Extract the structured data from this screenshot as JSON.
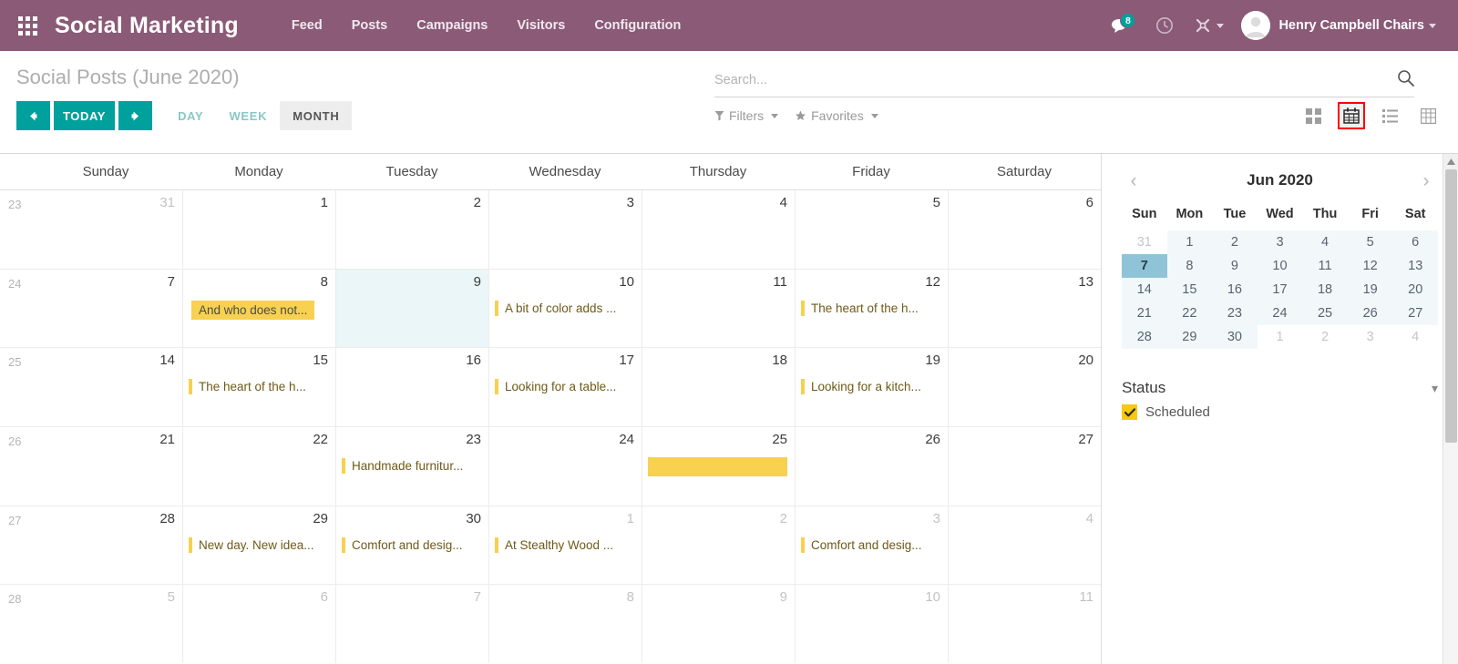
{
  "navbar": {
    "apps_icon": "apps-grid-icon",
    "brand": "Social Marketing",
    "menus": [
      {
        "label": "Feed"
      },
      {
        "label": "Posts"
      },
      {
        "label": "Campaigns"
      },
      {
        "label": "Visitors"
      },
      {
        "label": "Configuration"
      }
    ],
    "messages_icon": "chat-bubble-icon",
    "messages_count": "8",
    "activities_icon": "clock-icon",
    "debug_icon": "bug-tools-icon",
    "avatar_icon": "user-avatar-icon",
    "user_name": "Henry Campbell Chairs",
    "brand_color": "#8a5a77",
    "accent_color": "#00a09d"
  },
  "control_panel": {
    "title": "Social Posts (June 2020)",
    "search": {
      "placeholder": "Search...",
      "value": "",
      "icon": "search-icon"
    },
    "nav": {
      "prev_icon": "arrow-left-icon",
      "today_label": "TODAY",
      "next_icon": "arrow-right-icon"
    },
    "scales": [
      {
        "label": "DAY",
        "active": false
      },
      {
        "label": "WEEK",
        "active": false
      },
      {
        "label": "MONTH",
        "active": true
      }
    ],
    "filters_label": "Filters",
    "filters_icon": "funnel-icon",
    "favorites_label": "Favorites",
    "favorites_icon": "star-icon",
    "views": [
      {
        "name": "kanban-view-icon",
        "active": false
      },
      {
        "name": "calendar-view-icon",
        "active": true
      },
      {
        "name": "list-view-icon",
        "active": false
      },
      {
        "name": "pivot-view-icon",
        "active": false
      }
    ],
    "active_view_highlight": "#ff0000"
  },
  "calendar": {
    "weekdays": [
      "Sunday",
      "Monday",
      "Tuesday",
      "Wednesday",
      "Thursday",
      "Friday",
      "Saturday"
    ],
    "event_color": "#f7d04f",
    "rows": [
      {
        "week": "23",
        "days": [
          {
            "num": "31",
            "other": true,
            "hover": false,
            "events": []
          },
          {
            "num": "1",
            "other": false,
            "hover": false,
            "events": []
          },
          {
            "num": "2",
            "other": false,
            "hover": false,
            "events": []
          },
          {
            "num": "3",
            "other": false,
            "hover": false,
            "events": []
          },
          {
            "num": "4",
            "other": false,
            "hover": false,
            "events": []
          },
          {
            "num": "5",
            "other": false,
            "hover": false,
            "events": []
          },
          {
            "num": "6",
            "other": false,
            "hover": false,
            "events": []
          }
        ]
      },
      {
        "week": "24",
        "days": [
          {
            "num": "7",
            "other": false,
            "hover": false,
            "events": []
          },
          {
            "num": "8",
            "other": false,
            "hover": false,
            "events": [],
            "overflow_chip": "And who does not..."
          },
          {
            "num": "9",
            "other": false,
            "hover": true,
            "events": []
          },
          {
            "num": "10",
            "other": false,
            "hover": false,
            "events": [
              {
                "title": "A bit of color adds ..."
              }
            ]
          },
          {
            "num": "11",
            "other": false,
            "hover": false,
            "events": []
          },
          {
            "num": "12",
            "other": false,
            "hover": false,
            "events": [
              {
                "title": "The heart of the h..."
              }
            ]
          },
          {
            "num": "13",
            "other": false,
            "hover": false,
            "events": []
          }
        ]
      },
      {
        "week": "25",
        "days": [
          {
            "num": "14",
            "other": false,
            "hover": false,
            "events": []
          },
          {
            "num": "15",
            "other": false,
            "hover": false,
            "events": [
              {
                "title": "The heart of the h..."
              }
            ]
          },
          {
            "num": "16",
            "other": false,
            "hover": false,
            "events": []
          },
          {
            "num": "17",
            "other": false,
            "hover": false,
            "events": [
              {
                "title": "Looking for a table..."
              }
            ]
          },
          {
            "num": "18",
            "other": false,
            "hover": false,
            "events": []
          },
          {
            "num": "19",
            "other": false,
            "hover": false,
            "events": [
              {
                "title": "Looking for a kitch..."
              }
            ]
          },
          {
            "num": "20",
            "other": false,
            "hover": false,
            "events": []
          }
        ]
      },
      {
        "week": "26",
        "days": [
          {
            "num": "21",
            "other": false,
            "hover": false,
            "events": []
          },
          {
            "num": "22",
            "other": false,
            "hover": false,
            "events": []
          },
          {
            "num": "23",
            "other": false,
            "hover": false,
            "events": [
              {
                "title": "Handmade furnitur..."
              }
            ]
          },
          {
            "num": "24",
            "other": false,
            "hover": false,
            "events": []
          },
          {
            "num": "25",
            "other": false,
            "hover": false,
            "events": [],
            "drag_block": true
          },
          {
            "num": "26",
            "other": false,
            "hover": false,
            "events": []
          },
          {
            "num": "27",
            "other": false,
            "hover": false,
            "events": []
          }
        ]
      },
      {
        "week": "27",
        "days": [
          {
            "num": "28",
            "other": false,
            "hover": false,
            "events": []
          },
          {
            "num": "29",
            "other": false,
            "hover": false,
            "events": [
              {
                "title": "New day. New idea..."
              }
            ]
          },
          {
            "num": "30",
            "other": false,
            "hover": false,
            "events": [
              {
                "title": "Comfort and desig..."
              }
            ]
          },
          {
            "num": "1",
            "other": true,
            "hover": false,
            "events": [
              {
                "title": "At Stealthy Wood ..."
              }
            ]
          },
          {
            "num": "2",
            "other": true,
            "hover": false,
            "events": []
          },
          {
            "num": "3",
            "other": true,
            "hover": false,
            "events": [
              {
                "title": "Comfort and desig..."
              }
            ]
          },
          {
            "num": "4",
            "other": true,
            "hover": false,
            "events": []
          }
        ]
      },
      {
        "week": "28",
        "days": [
          {
            "num": "5",
            "other": true,
            "hover": false,
            "events": []
          },
          {
            "num": "6",
            "other": true,
            "hover": false,
            "events": []
          },
          {
            "num": "7",
            "other": true,
            "hover": false,
            "events": []
          },
          {
            "num": "8",
            "other": true,
            "hover": false,
            "events": []
          },
          {
            "num": "9",
            "other": true,
            "hover": false,
            "events": []
          },
          {
            "num": "10",
            "other": true,
            "hover": false,
            "events": []
          },
          {
            "num": "11",
            "other": true,
            "hover": false,
            "events": []
          }
        ]
      }
    ]
  },
  "side_panel": {
    "mini_calendar": {
      "title": "Jun 2020",
      "prev_icon": "chevron-left-icon",
      "next_icon": "chevron-right-icon",
      "dow": [
        "Sun",
        "Mon",
        "Tue",
        "Wed",
        "Thu",
        "Fri",
        "Sat"
      ],
      "today": "7",
      "today_color": "#8fc4d8",
      "weeks": [
        [
          {
            "n": "31",
            "in": false
          },
          {
            "n": "1",
            "in": true
          },
          {
            "n": "2",
            "in": true
          },
          {
            "n": "3",
            "in": true
          },
          {
            "n": "4",
            "in": true
          },
          {
            "n": "5",
            "in": true
          },
          {
            "n": "6",
            "in": true
          }
        ],
        [
          {
            "n": "7",
            "in": true,
            "today": true
          },
          {
            "n": "8",
            "in": true
          },
          {
            "n": "9",
            "in": true
          },
          {
            "n": "10",
            "in": true
          },
          {
            "n": "11",
            "in": true
          },
          {
            "n": "12",
            "in": true
          },
          {
            "n": "13",
            "in": true
          }
        ],
        [
          {
            "n": "14",
            "in": true
          },
          {
            "n": "15",
            "in": true
          },
          {
            "n": "16",
            "in": true
          },
          {
            "n": "17",
            "in": true
          },
          {
            "n": "18",
            "in": true
          },
          {
            "n": "19",
            "in": true
          },
          {
            "n": "20",
            "in": true
          }
        ],
        [
          {
            "n": "21",
            "in": true
          },
          {
            "n": "22",
            "in": true
          },
          {
            "n": "23",
            "in": true
          },
          {
            "n": "24",
            "in": true
          },
          {
            "n": "25",
            "in": true
          },
          {
            "n": "26",
            "in": true
          },
          {
            "n": "27",
            "in": true
          }
        ],
        [
          {
            "n": "28",
            "in": true
          },
          {
            "n": "29",
            "in": true
          },
          {
            "n": "30",
            "in": true
          },
          {
            "n": "1",
            "in": false
          },
          {
            "n": "2",
            "in": false
          },
          {
            "n": "3",
            "in": false
          },
          {
            "n": "4",
            "in": false
          }
        ]
      ]
    },
    "status": {
      "section_label": "Status",
      "collapse_icon": "chevron-down-icon",
      "items": [
        {
          "label": "Scheduled",
          "checked": true,
          "color": "#f7c90f"
        }
      ]
    }
  },
  "scrollbar": {
    "up_icon": "scroll-up-arrow-icon"
  }
}
